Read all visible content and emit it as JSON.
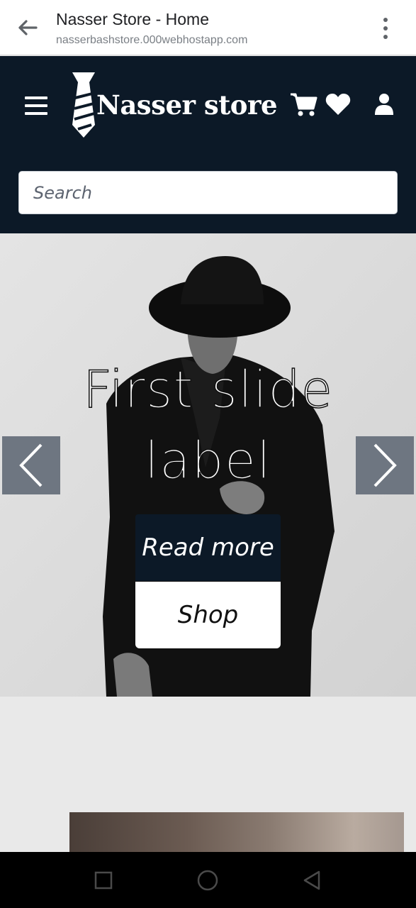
{
  "browser": {
    "title": "Nasser Store - Home",
    "url": "nasserbashstore.000webhostapp.com",
    "back_icon": "arrow-left-icon",
    "menu_icon": "more-vert-icon"
  },
  "header": {
    "brand": "Nasser store",
    "logo_icon": "tie-icon",
    "menu_icon": "hamburger-icon",
    "icons": [
      "cart-icon",
      "heart-icon",
      "user-icon"
    ],
    "background_color": "#0c1927"
  },
  "search": {
    "placeholder": "Search",
    "value": ""
  },
  "carousel": {
    "slide_title_line1": "First slide",
    "slide_title_line2": "label",
    "read_more_label": "Read more",
    "shop_label": "Shop",
    "prev_icon": "chevron-left-icon",
    "next_icon": "chevron-right-icon"
  },
  "android_nav": {
    "icons": [
      "recents-icon",
      "home-icon",
      "back-triangle-icon"
    ]
  }
}
